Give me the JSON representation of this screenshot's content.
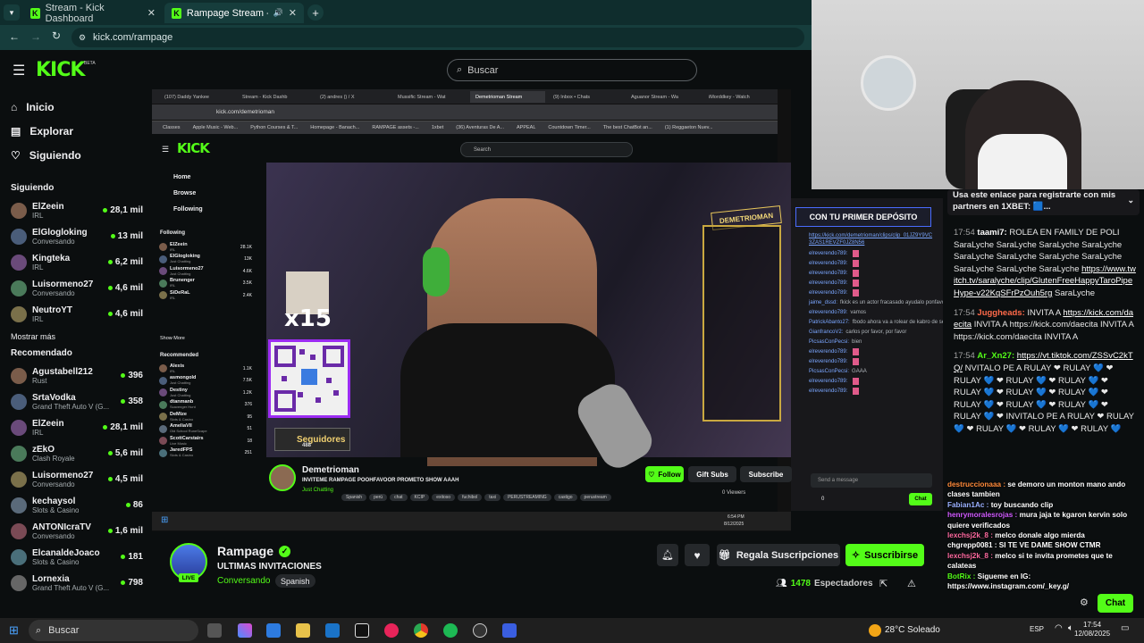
{
  "browser": {
    "tabs": [
      {
        "title": "Stream - Kick Dashboard",
        "active": false
      },
      {
        "title": "Rampage Stream - Watch L",
        "active": true
      }
    ],
    "url": "kick.com/rampage"
  },
  "header": {
    "logo": "KICK",
    "beta": "BETA",
    "search_placeholder": "Buscar"
  },
  "sidebar": {
    "nav": [
      {
        "label": "Inicio",
        "icon": "home-icon"
      },
      {
        "label": "Explorar",
        "icon": "compass-icon"
      },
      {
        "label": "Siguiendo",
        "icon": "heart-icon"
      }
    ],
    "following_title": "Siguiendo",
    "following": [
      {
        "name": "ElZeein",
        "category": "IRL",
        "viewers": "28,1 mil"
      },
      {
        "name": "ElGlogloking",
        "category": "Conversando",
        "viewers": "13 mil"
      },
      {
        "name": "Kingteka",
        "category": "IRL",
        "viewers": "6,2 mil"
      },
      {
        "name": "Luisormeno27",
        "category": "Conversando",
        "viewers": "4,6 mil"
      },
      {
        "name": "NeutroYT",
        "category": "IRL",
        "viewers": "4,6 mil"
      }
    ],
    "show_more": "Mostrar más",
    "recommended_title": "Recomendado",
    "recommended": [
      {
        "name": "Agustabell212",
        "category": "Rust",
        "viewers": "396"
      },
      {
        "name": "SrtaVodka",
        "category": "Grand Theft Auto V (G...",
        "viewers": "358"
      },
      {
        "name": "ElZeein",
        "category": "IRL",
        "viewers": "28,1 mil"
      },
      {
        "name": "zEkO",
        "category": "Clash Royale",
        "viewers": "5,6 mil"
      },
      {
        "name": "Luisormeno27",
        "category": "Conversando",
        "viewers": "4,5 mil"
      },
      {
        "name": "kechaysol",
        "category": "Slots & Casino",
        "viewers": "86"
      },
      {
        "name": "ANTONIcraTV",
        "category": "Conversando",
        "viewers": "1,6 mil"
      },
      {
        "name": "ElcanaldeJoaco",
        "category": "Slots & Casino",
        "viewers": "181"
      },
      {
        "name": "Lornexia",
        "category": "Grand Theft Auto V (G...",
        "viewers": "798"
      }
    ]
  },
  "inner": {
    "tabs": [
      "(107) Daddy Yankee",
      "Stream - Kick Dashb",
      "(2) andres () / X",
      "Mussific Stream - Wat",
      "Demetrioman Stream",
      "(9) Inbox • Chats",
      "Aguanor Stream - Wa",
      "iMorddkey - Watch"
    ],
    "url": "kick.com/demetrioman",
    "bookmarks": [
      "Classes",
      "Apple Music - Web...",
      "Python Courses & T...",
      "Homepage - Banach...",
      "RAMPAGE assets -...",
      "1xbet",
      "(36) Aventuras De A...",
      "APPEAL",
      "Countdown Timer...",
      "The best ChatBot an...",
      "(1) Reggaeton Nuev..."
    ],
    "logo": "KICK",
    "search": "Search",
    "nav": [
      "Home",
      "Browse",
      "Following"
    ],
    "following_title": "Following",
    "following": [
      {
        "name": "ElZeein",
        "category": "IRL",
        "viewers": "28.1K"
      },
      {
        "name": "ElGlogloking",
        "category": "Just Chatting",
        "viewers": "13K"
      },
      {
        "name": "Luisormeno27",
        "category": "Just Chatting",
        "viewers": "4.6K"
      },
      {
        "name": "Brunenger",
        "category": "IRL",
        "viewers": "3.5K"
      },
      {
        "name": "SiDeRaL",
        "category": "IRL",
        "viewers": "2.4K"
      }
    ],
    "show_more": "Show More",
    "recommended_title": "Recommended",
    "recommended": [
      {
        "name": "Alexis",
        "category": "IRL",
        "viewers": "1.1K"
      },
      {
        "name": "asmongold",
        "category": "Just Chatting",
        "viewers": "7.5K"
      },
      {
        "name": "Destiny",
        "category": "Just Chatting",
        "viewers": "1.2K"
      },
      {
        "name": "dtanmanb",
        "category": "Scavenger Hunt",
        "viewers": "376"
      },
      {
        "name": "DeMize",
        "category": "Slots & Casino",
        "viewers": "95"
      },
      {
        "name": "AmeliaVII",
        "category": "Old School RuneScape",
        "viewers": "51"
      },
      {
        "name": "ScottCarstairs",
        "category": "Live Music",
        "viewers": "18"
      },
      {
        "name": "JaredFPS",
        "category": "Slots & Casino",
        "viewers": "251"
      }
    ],
    "overlay_name": "DEMETRIOMAN",
    "multiplier": "x15",
    "followers_label": "Seguidores",
    "followers_count": "488",
    "streamer": "Demetrioman",
    "stream_title": "INVITEME RAMPAGE POOHFAVOOR PROMETO SHOW AAAH",
    "category": "Just Chatting",
    "tags": [
      "Spanish",
      "perú",
      "chat",
      "KCIP",
      "exitoso",
      "fuchibol",
      "taxi",
      "PERUSTREAMING",
      "castigo",
      "perustream"
    ],
    "follow": "Follow",
    "gift": "Gift Subs",
    "subscribe": "Subscribe",
    "viewers": "0 Viewers",
    "promo": "CON TU PRIMER DEPÓSITO",
    "chat_link": "https://kick.com/demetrioman/clips/clip_01JZ9Y9VC3ZAS1REVZF0JZ8N56",
    "chat_lines": [
      {
        "user": "elreverendo789:",
        "text": ""
      },
      {
        "user": "elreverendo789:",
        "text": ""
      },
      {
        "user": "elreverendo789:",
        "text": ""
      },
      {
        "user": "elreverendo789:",
        "text": ""
      },
      {
        "user": "elreverendo789:",
        "text": ""
      },
      {
        "user": "jaime_dssd:",
        "text": "fkick es un actor fracasado ayudalo ponfavor"
      },
      {
        "user": "elreverendo789:",
        "text": "vamos"
      },
      {
        "user": "PatrickAbanto27:",
        "text": "fbodo ahora va a rolear de kabro de sepita"
      },
      {
        "user": "GianfrancoV2:",
        "text": "carlos por favor, por favor"
      },
      {
        "user": "PicsasConPecsi:",
        "text": "bien"
      },
      {
        "user": "elreverendo789:",
        "text": ""
      },
      {
        "user": "elreverendo789:",
        "text": ""
      },
      {
        "user": "PicsasConPecsi:",
        "text": "GAAA"
      },
      {
        "user": "elreverendo789:",
        "text": ""
      },
      {
        "user": "elreverendo789:",
        "text": ""
      }
    ],
    "send_placeholder": "Send a message",
    "chat_count": "0",
    "chat_button": "Chat",
    "clock_time": "6:54 PM",
    "clock_date": "8/12/2025"
  },
  "right_chat": {
    "pinned": "Usa este enlace para registrarte con mis partners en 1XBET: 🟦...",
    "messages": [
      {
        "time": "17:54",
        "user": "taami7:",
        "user_color": "#ffffff",
        "text": "ROLEA EN FAMILY DE POLI SaraLyche SaraLyche SaraLyche SaraLyche SaraLyche SaraLyche SaraLyche SaraLyche SaraLyche SaraLyche SaraLyche",
        "link": "https://www.twitch.tv/saralyche/clip/GlutenFreeHappyTaroPipeHype-v22KqSFrPzOuh5rg",
        "tail": "SaraLyche"
      },
      {
        "time": "17:54",
        "user": "Juggheads:",
        "user_color": "#ff6a4a",
        "text": "INVITA A",
        "link": "https://kick.com/daecita",
        "tail": "INVITA A https://kick.com/daecita INVITA A https://kick.com/daecita INVITA A"
      },
      {
        "time": "17:54",
        "user": "Ar_Xn27:",
        "user_color": "#53fc18",
        "text": "",
        "link": "https://vt.tiktok.com/ZSSvC2kTQ/",
        "tail": "NVITALO PE A RULAY ❤ RULAY 💙 ❤ RULAY 💙 ❤ RULAY 💙 ❤ RULAY 💙 ❤ RULAY 💙 ❤ RULAY 💙 ❤ RULAY 💙 ❤ RULAY 💙 ❤ RULAY 💙 ❤ RULAY 💙 ❤ RULAY 💙 ❤ INVITALO PE A RULAY ❤ RULAY 💙 ❤ RULAY 💙 ❤ RULAY 💙 ❤ RULAY 💙"
      }
    ],
    "overlap_lines": [
      {
        "user": "destruccionaaa :",
        "text": "se demoro un monton mano ando clases tambien"
      },
      {
        "user": "Fabian1Ac :",
        "text": "toy buscando clip"
      },
      {
        "user": "henrymoralesrojas :",
        "text": "mura jaja te kgaron kervin solo quiere verificados"
      },
      {
        "user": "lexchsj2k_8 :",
        "text": "melco donale algo mierda"
      },
      {
        "user": "chgrepp0081 :",
        "text": "SI TE VE DAME SHOW CTMR"
      },
      {
        "user": "lexchsj2k_8 :",
        "text": "melco si te invita prometes que te calateas"
      },
      {
        "user": "BotRix :",
        "text": "Sigueme en IG: https://www.instagram.com/_key.g/"
      }
    ],
    "chat_button": "Chat"
  },
  "stream": {
    "name": "Rampage",
    "title": "ULTIMAS INVITACIONES",
    "category": "Conversando",
    "language": "Spanish",
    "live": "LIVE",
    "gift": "Regala Suscripciones",
    "subscribe": "Suscribirse",
    "viewers": "1478",
    "viewers_label": "Espectadores"
  },
  "taskbar": {
    "search": "Buscar",
    "weather": "28°C  Soleado",
    "lang": "ESP",
    "time": "17:54",
    "date": "12/08/2025"
  },
  "colors": {
    "accent": "#53fc18",
    "background": "#0b0e0f",
    "tab_bar": "#0f2d2d"
  }
}
